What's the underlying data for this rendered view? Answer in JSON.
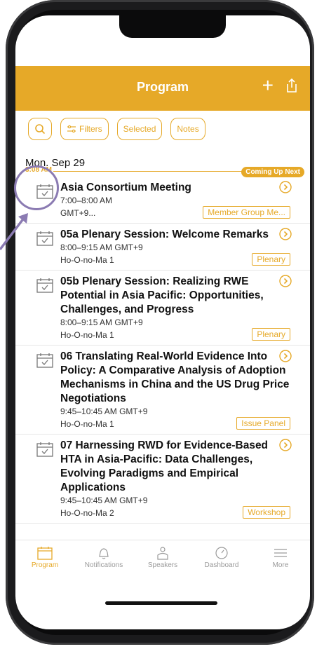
{
  "header": {
    "title": "Program"
  },
  "toolbar": {
    "filters_label": "Filters",
    "selected_label": "Selected",
    "notes_label": "Notes"
  },
  "timeline": {
    "date": "Mon, Sep 29",
    "now_time": "3:08 AM",
    "coming_up_next_label": "Coming Up Next"
  },
  "sessions": [
    {
      "title": "Asia Consortium Meeting",
      "time": "7:00–8:00 AM",
      "time_extra": "GMT+9...",
      "location": "",
      "tag": "Member Group Me..."
    },
    {
      "title": "05a Plenary Session: Welcome Remarks",
      "time": "8:00–9:15 AM GMT+9",
      "location": "Ho-O-no-Ma 1",
      "tag": "Plenary"
    },
    {
      "title": "05b Plenary Session: Realizing RWE Potential in Asia Pacific: Opportunities, Challenges, and Progress",
      "time": "8:00–9:15 AM GMT+9",
      "location": "Ho-O-no-Ma 1",
      "tag": "Plenary"
    },
    {
      "title": "06 Translating Real-World Evidence Into Policy: A Comparative Analysis of Adoption Mechanisms in China and the US Drug Price Negotiations",
      "time": "9:45–10:45 AM GMT+9",
      "location": "Ho-O-no-Ma 1",
      "tag": "Issue Panel"
    },
    {
      "title": "07 Harnessing RWD for Evidence-Based HTA in Asia-Pacific: Data Challenges, Evolving Paradigms and Empirical Applications",
      "time": "9:45–10:45 AM GMT+9",
      "location": "Ho-O-no-Ma 2",
      "tag": "Workshop"
    }
  ],
  "tabbar": {
    "items": [
      {
        "label": "Program",
        "icon": "calendar-icon"
      },
      {
        "label": "Notifications",
        "icon": "bell-icon"
      },
      {
        "label": "Speakers",
        "icon": "person-icon"
      },
      {
        "label": "Dashboard",
        "icon": "gauge-icon"
      },
      {
        "label": "More",
        "icon": "menu-icon"
      }
    ]
  },
  "colors": {
    "accent": "#e6a928",
    "highlight_ring": "#8b7bb2"
  }
}
